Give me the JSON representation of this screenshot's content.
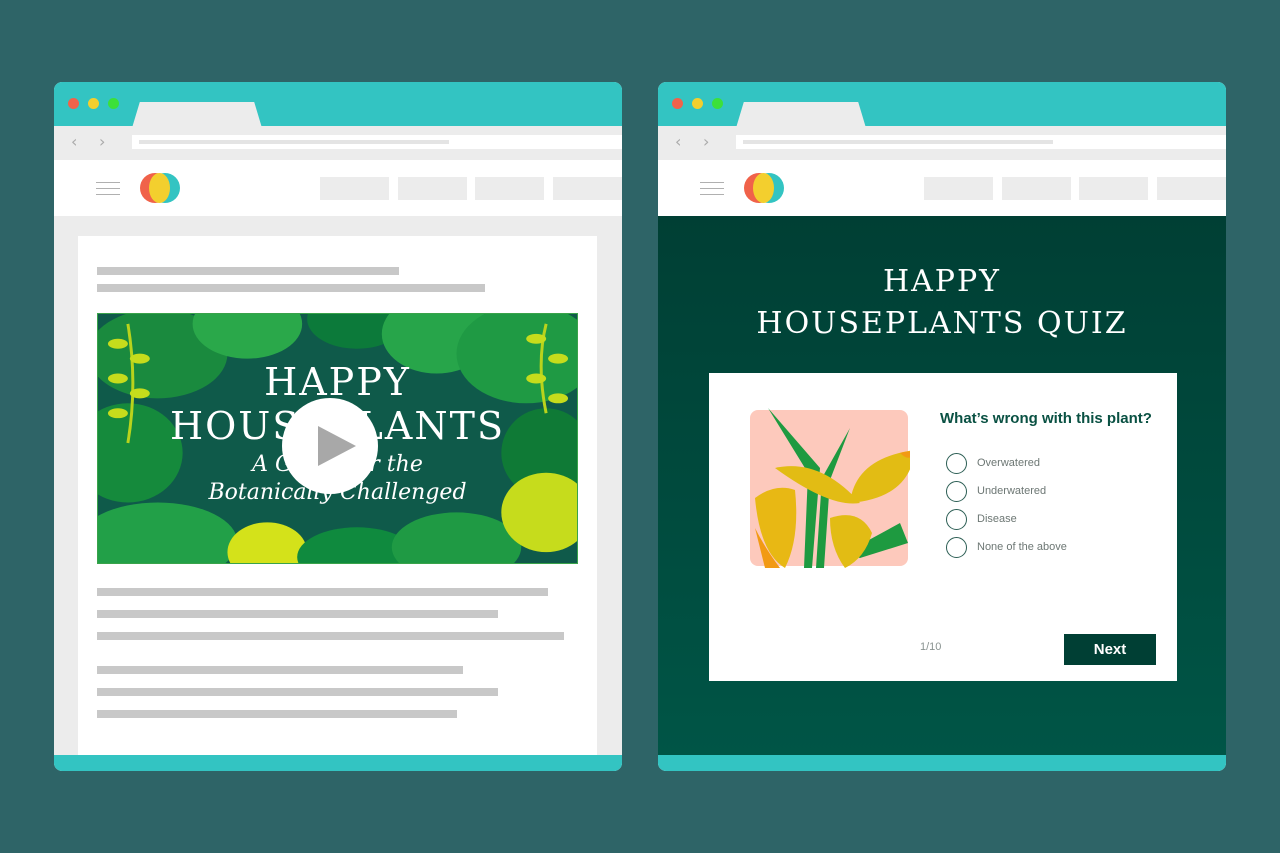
{
  "colors": {
    "background": "#2e6467",
    "chrome_teal": "#33c4c2",
    "dot_red": "#f0624a",
    "dot_yellow": "#f3cf2e",
    "dot_green": "#3ce03a",
    "quiz_green": "#003f34",
    "question_green": "#0a5143",
    "plant_bg": "#fdc9bc"
  },
  "left_browser": {
    "nav_back_icon": "‹",
    "nav_forward_icon": "›",
    "video": {
      "title_line1": "HAPPY",
      "title_line2": "HOUSEPLANTS",
      "subtitle_line1": "A Guide for the",
      "subtitle_line2": "Botanically Challenged",
      "play_icon": "play-icon"
    }
  },
  "right_browser": {
    "nav_back_icon": "‹",
    "nav_forward_icon": "›",
    "quiz": {
      "title_line1": "HAPPY",
      "title_line2": "HOUSEPLANTS QUIZ",
      "question": "What’s wrong with this plant?",
      "options": [
        {
          "label": "Overwatered",
          "selected": false
        },
        {
          "label": "Underwatered",
          "selected": false
        },
        {
          "label": "Disease",
          "selected": false
        },
        {
          "label": "None of the above",
          "selected": false
        }
      ],
      "progress": "1/10",
      "next_label": "Next"
    }
  }
}
